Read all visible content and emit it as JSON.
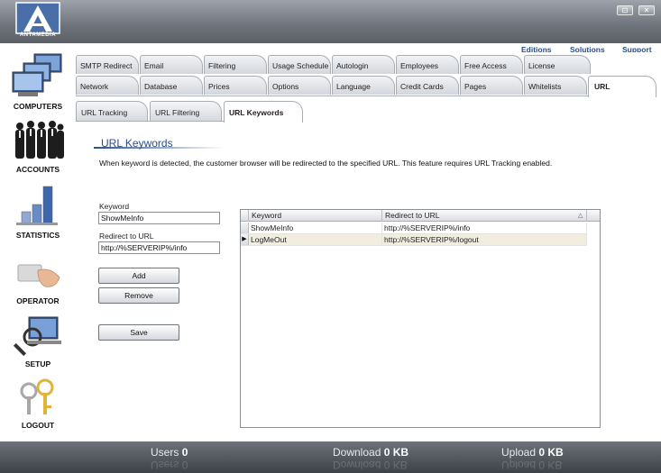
{
  "app": {
    "logo_text": "ANTAMEDIA"
  },
  "window_buttons": {
    "minimize": "⊡",
    "close": "✕"
  },
  "sidebar": {
    "items": [
      {
        "label": "COMPUTERS",
        "icon": "computers-icon"
      },
      {
        "label": "ACCOUNTS",
        "icon": "accounts-icon"
      },
      {
        "label": "STATISTICS",
        "icon": "statistics-icon"
      },
      {
        "label": "OPERATOR",
        "icon": "operator-icon"
      },
      {
        "label": "SETUP",
        "icon": "setup-icon"
      },
      {
        "label": "LOGOUT",
        "icon": "logout-icon"
      }
    ]
  },
  "toplinks": {
    "editions": "Editions",
    "solutions": "Solutions",
    "support": "Support"
  },
  "tabs_row1": [
    "SMTP Redirect",
    "Email",
    "Filtering",
    "Usage Schedule",
    "Autologin",
    "Employees",
    "Free Access",
    "License"
  ],
  "tabs_row2": [
    "Network",
    "Database",
    "Prices",
    "Options",
    "Language",
    "Credit Cards",
    "Pages",
    "Whitelists",
    "URL"
  ],
  "subtabs": [
    "URL Tracking",
    "URL Filtering",
    "URL Keywords"
  ],
  "page": {
    "title": "URL Keywords",
    "description": "When keyword is detected, the customer browser will be redirected to the specified URL. This feature requires URL Tracking enabled.",
    "keyword_label": "Keyword",
    "keyword_value": "ShowMeInfo",
    "redirect_label": "Redirect to URL",
    "redirect_value": "http://%SERVERIP%/info",
    "add_label": "Add",
    "remove_label": "Remove",
    "save_label": "Save"
  },
  "grid": {
    "columns": [
      "Keyword",
      "Redirect to URL"
    ],
    "rows": [
      {
        "keyword": "ShowMeInfo",
        "url": "http://%SERVERIP%/info"
      },
      {
        "keyword": "LogMeOut",
        "url": "http://%SERVERIP%/logout"
      }
    ]
  },
  "status": {
    "users_label": "Users",
    "users_value": "0",
    "download_label": "Download",
    "download_value": "0 KB",
    "upload_label": "Upload",
    "upload_value": "0 KB"
  },
  "colors": {
    "accent": "#2a4f8c",
    "selected_row": "#f1eee0"
  }
}
